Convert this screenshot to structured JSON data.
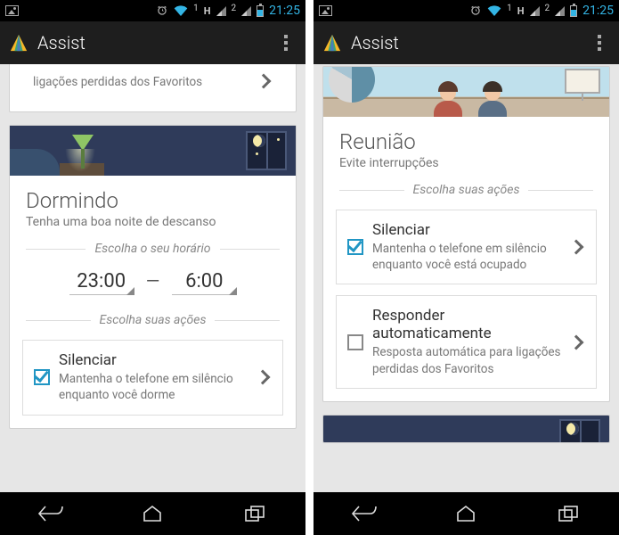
{
  "status": {
    "time": "21:25",
    "h_indicator": "H",
    "sim1": "1",
    "sim2": "2"
  },
  "app": {
    "title": "Assist"
  },
  "left": {
    "partial_prev_desc": "ligações perdidas dos Favoritos",
    "card": {
      "title": "Dormindo",
      "sub": "Tenha uma boa noite de descanso",
      "section_time": "Escolha o seu horário",
      "time_start": "23:00",
      "time_end": "6:00",
      "dash": "—",
      "section_actions": "Escolha suas ações",
      "action": {
        "title": "Silenciar",
        "desc": "Mantenha o telefone em silêncio enquanto você dorme"
      }
    }
  },
  "right": {
    "card": {
      "title": "Reunião",
      "sub": "Evite interrupções",
      "section_actions": "Escolha suas ações",
      "action1": {
        "title": "Silenciar",
        "desc": "Mantenha o telefone em silêncio enquanto você está ocupado"
      },
      "action2": {
        "title": "Responder automaticamente",
        "desc": "Resposta automática para ligações perdidas dos Favoritos"
      }
    }
  }
}
